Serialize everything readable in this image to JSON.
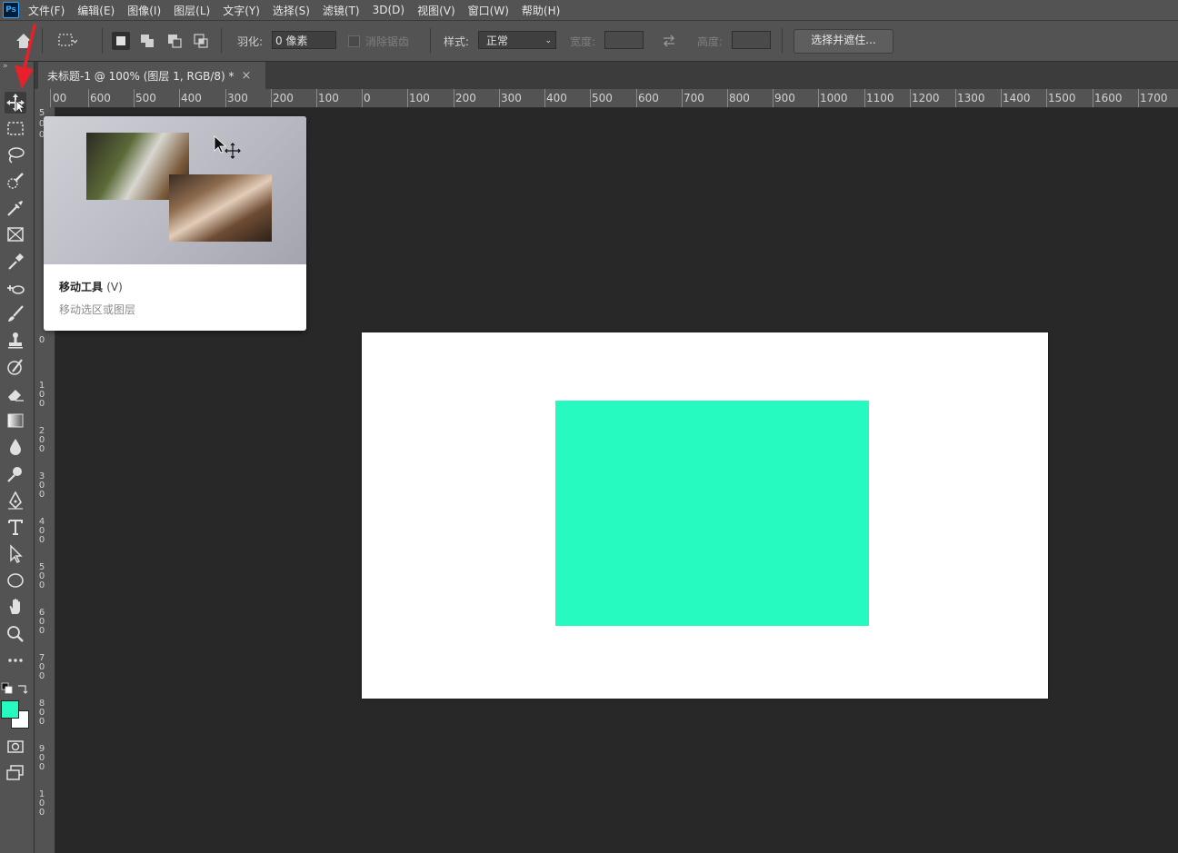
{
  "app": {
    "logo": "Ps"
  },
  "menu": [
    "文件(F)",
    "编辑(E)",
    "图像(I)",
    "图层(L)",
    "文字(Y)",
    "选择(S)",
    "滤镜(T)",
    "3D(D)",
    "视图(V)",
    "窗口(W)",
    "帮助(H)"
  ],
  "options": {
    "feather_label": "羽化:",
    "feather_value": "0 像素",
    "antialias_label": "消除锯齿",
    "style_label": "样式:",
    "style_value": "正常",
    "width_label": "宽度:",
    "height_label": "高度:",
    "refine_button": "选择并遮住..."
  },
  "tab": {
    "title": "未标题-1 @ 100% (图层 1, RGB/8) *",
    "close": "×"
  },
  "ruler": {
    "top_labels": [
      "00",
      "600",
      "500",
      "400",
      "300",
      "200",
      "100",
      "0",
      "100",
      "200",
      "300",
      "400",
      "500",
      "600",
      "700",
      "800",
      "900",
      "1000",
      "1100",
      "1200",
      "1300",
      "1400",
      "1500",
      "1600",
      "1700"
    ],
    "left_labels": [
      "5",
      "0",
      "0",
      "0",
      "100",
      "200",
      "300",
      "400",
      "500",
      "600",
      "700",
      "800",
      "900",
      "100"
    ]
  },
  "tooltip": {
    "title": "移动工具",
    "shortcut": "(V)",
    "description": "移动选区或图层"
  },
  "colors": {
    "foreground": "#26fac0",
    "background": "#ffffff",
    "shape": "#26fac0",
    "arrow": "#e8202a"
  },
  "tools": [
    "move-tool",
    "marquee-tool",
    "lasso-tool",
    "quick-select-tool",
    "eyedropper-tool",
    "frame-tool",
    "color-sampler-tool",
    "healing-tool",
    "brush-tool",
    "stamp-tool",
    "history-brush-tool",
    "eraser-tool",
    "gradient-tool",
    "blur-tool",
    "dodge-tool",
    "pen-tool",
    "type-tool",
    "path-select-tool",
    "ellipse-tool",
    "hand-tool",
    "zoom-tool",
    "more-tools"
  ]
}
